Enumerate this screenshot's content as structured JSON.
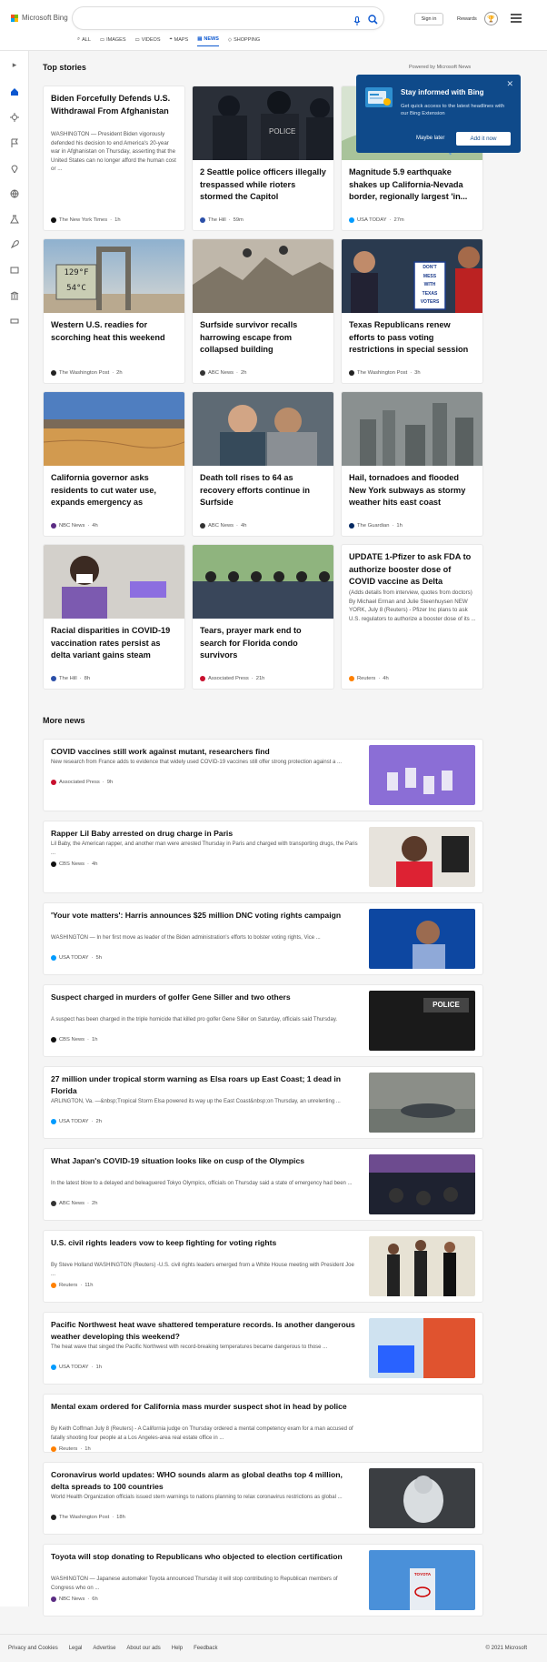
{
  "header": {
    "brand": "Microsoft Bing",
    "search_value": "",
    "sign_in": "Sign in",
    "rewards": "Rewards",
    "tabs": [
      "ALL",
      "IMAGES",
      "VIDEOS",
      "MAPS",
      "NEWS",
      "SHOPPING"
    ],
    "active_tab": "NEWS"
  },
  "top_stories": {
    "heading": "Top stories",
    "powered_by": "Powered by Microsoft News",
    "cards": [
      {
        "title": "Biden Forcefully Defends U.S. Withdrawal From Afghanistan",
        "snippet": "WASHINGTON — President Biden vigorously defended his decision to end America's 20-year war in Afghanistan on Thursday, asserting that the United States can no longer afford the human cost or ...",
        "source": "The New York Times",
        "time": "1h",
        "image": null
      },
      {
        "title": "2 Seattle police officers illegally trespassed while rioters stormed the Capitol",
        "source": "The Hill",
        "time": "59m",
        "image": "police"
      },
      {
        "title": "Magnitude 5.9 earthquake shakes up California-Nevada border, regionally largest 'in...",
        "source": "USA TODAY",
        "time": "27m",
        "image": "quake"
      },
      {
        "title": "Western U.S. readies for scorching heat this weekend",
        "source": "The Washington Post",
        "time": "2h",
        "image": "heat"
      },
      {
        "title": "Surfside survivor recalls harrowing escape from collapsed building",
        "source": "ABC News",
        "time": "2h",
        "image": "rubble"
      },
      {
        "title": "Texas Republicans renew efforts to pass voting restrictions in special session",
        "source": "The Washington Post",
        "time": "3h",
        "image": "protest"
      },
      {
        "title": "California governor asks residents to cut water use, expands emergency as drough...",
        "source": "NBC News",
        "time": "4h",
        "image": "lake"
      },
      {
        "title": "Death toll rises to 64 as recovery efforts continue in Surfside",
        "source": "ABC News",
        "time": "4h",
        "image": "hug"
      },
      {
        "title": "Hail, tornadoes and flooded New York subways as stormy weather hits east coast",
        "source": "The Guardian",
        "time": "1h",
        "image": "city"
      },
      {
        "title": "Racial disparities in COVID-19 vaccination rates persist as delta variant gains steam",
        "source": "The Hill",
        "time": "8h",
        "image": "vaccine"
      },
      {
        "title": "Tears, prayer mark end to search for Florida condo survivors",
        "source": "Associated Press",
        "time": "21h",
        "image": "crowd"
      },
      {
        "title": "UPDATE 1-Pfizer to ask FDA to authorize booster dose of COVID vaccine as Delta varian...",
        "snippet": "(Adds details from interview, quotes from doctors) By Michael Erman and Julie Steenhuysen NEW YORK, July 8 (Reuters) - Pfizer Inc plans to ask U.S. regulators to authorize a booster dose of its ...",
        "source": "Reuters",
        "time": "4h",
        "image": null
      }
    ]
  },
  "more_news": {
    "heading": "More news",
    "items": [
      {
        "title": "COVID vaccines still work against mutant, researchers find",
        "snippet": "New research from France adds to evidence that widely used COVID-19 vaccines still offer strong protection against a ...",
        "source": "Associated Press",
        "time": "9h",
        "image": "vials"
      },
      {
        "title": "Rapper Lil Baby arrested on drug charge in Paris",
        "snippet": "Lil Baby, the American rapper, and another man were arrested Thursday in Paris and charged with transporting drugs, the Paris ...",
        "source": "CBS News",
        "time": "4h",
        "image": "rapper"
      },
      {
        "title": "'Your vote matters': Harris announces $25 million DNC voting rights campaign",
        "snippet": "WASHINGTON — In her first move as leader of the Biden administration's efforts to bolster voting rights, Vice ...",
        "source": "USA TODAY",
        "time": "5h",
        "image": "harris"
      },
      {
        "title": "Suspect charged in murders of golfer Gene Siller and two others",
        "snippet": "A suspect has been charged in the triple homicide that killed pro golfer Gene Siller on Saturday, officials said Thursday.",
        "source": "CBS News",
        "time": "1h",
        "image": "policevest",
        "badge": "POLICE"
      },
      {
        "title": "27 million under tropical storm warning as Elsa roars up East Coast; 1 dead in Florida",
        "snippet": "ARLINGTON, Va. —&nbsp;Tropical Storm Elsa powered its way up the East Coast&nbsp;on Thursday, an unrelenting ...",
        "source": "USA TODAY",
        "time": "2h",
        "image": "flood"
      },
      {
        "title": "What Japan's COVID-19 situation looks like on cusp of the Olympics",
        "snippet": "In the latest blow to a delayed and beleaguered Tokyo Olympics, officials on Thursday said a state of emergency had been ...",
        "source": "ABC News",
        "time": "2h",
        "image": "tokyo"
      },
      {
        "title": "U.S. civil rights leaders vow to keep fighting for voting rights",
        "snippet": "By Steve Holland WASHINGTON (Reuters) -U.S. civil rights leaders emerged from a White House meeting with President Joe ...",
        "source": "Reuters",
        "time": "11h",
        "image": "whitehouse"
      },
      {
        "title": "Pacific Northwest heat wave shattered temperature records. Is another dangerous weather developing this weekend?",
        "snippet": "The heat wave that singed the Pacific Northwest with record-breaking temperatures became dangerous to those ...",
        "source": "USA TODAY",
        "time": "1h",
        "image": "station"
      },
      {
        "title": "Mental exam ordered for California mass murder suspect shot in head by police",
        "snippet": "By Keith Coffman July 8 (Reuters) - A California judge on Thursday ordered a mental competency exam for a man accused of fatally shooting four people at a Los Angeles-area real estate office in ...",
        "source": "Reuters",
        "time": "1h",
        "image": null
      },
      {
        "title": "Coronavirus world updates: WHO sounds alarm as global deaths top 4 million, delta spreads to 100 countries",
        "snippet": "World Health Organization officials issued stern warnings to nations planning to relax coronavirus restrictions as global ...",
        "source": "The Washington Post",
        "time": "18h",
        "image": "ppe"
      },
      {
        "title": "Toyota will stop donating to Republicans who objected to election certification",
        "snippet": "WASHINGTON — Japanese automaker Toyota announced Thursday it will stop contributing to Republican members of Congress who on ...",
        "source": "NBC News",
        "time": "6h",
        "image": "toyota",
        "badge": "TOYOTA"
      }
    ]
  },
  "popup": {
    "title": "Stay informed with Bing",
    "desc": "Get quick access to the latest headlines with our Bing Extension",
    "maybe_later": "Maybe later",
    "add": "Add it now"
  },
  "heat_readout": {
    "f": "129°F",
    "c": "54°C"
  },
  "protest_sign": [
    "DON'T",
    "MESS",
    "WITH",
    "TEXAS",
    "VOTERS"
  ],
  "footer": {
    "links": [
      "Privacy and Cookies",
      "Legal",
      "Advertise",
      "About our ads",
      "Help",
      "Feedback"
    ],
    "copyright": "© 2021 Microsoft"
  },
  "colors": {
    "accent": "#0b57d0",
    "popup": "#0f4a8a"
  }
}
